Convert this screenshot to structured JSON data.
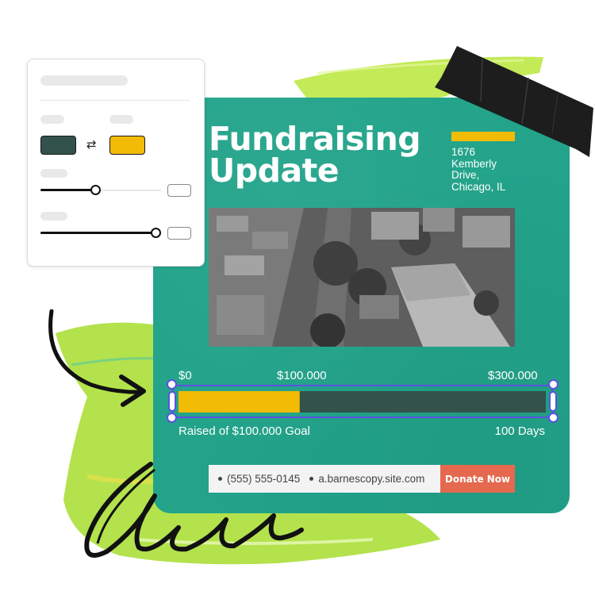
{
  "flyer": {
    "title_line1": "Fundraising",
    "title_line2": "Update",
    "address_lines": [
      "1676",
      "Kemberly",
      "Drive,",
      "Chicago, IL"
    ],
    "photo_alt": "Aerial black-and-white photo of a flooded neighborhood",
    "progress": {
      "tick_start": "$0",
      "tick_current": "$100.000",
      "tick_end": "$300.000",
      "raised_fraction": 0.33,
      "caption_left": "Raised of $100.000 Goal",
      "caption_right": "100 Days"
    },
    "contact": {
      "phone": "(555) 555-0145",
      "website": "a.barnescopy.site.com"
    },
    "donate_label": "Donate Now"
  },
  "editor_panel": {
    "swap_icon": "⇄",
    "color_from": "#33524c",
    "color_to": "#f2bb05",
    "slider1_value": 0.45,
    "slider2_value": 1.0
  },
  "colors": {
    "card": "#22a38a",
    "accent": "#f2bb05",
    "track": "#33524c",
    "donate": "#e5694e",
    "selection": "#5b52e0"
  },
  "decorations": [
    "paint-stroke-green",
    "black-tape",
    "curved-arrow",
    "scribble"
  ]
}
